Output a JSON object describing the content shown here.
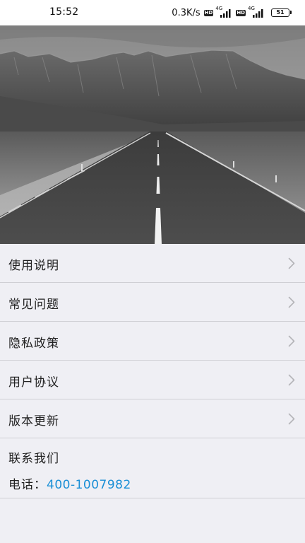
{
  "status_bar": {
    "time": "15:52",
    "net_speed": "0.3K/s",
    "hd_label": "HD",
    "sim1_tech": "4G",
    "sim2_tech": "4G",
    "battery": "51"
  },
  "hero": {
    "image": "mountain-road-photo"
  },
  "menu": {
    "items": [
      {
        "label": "使用说明"
      },
      {
        "label": "常见问题"
      },
      {
        "label": "隐私政策"
      },
      {
        "label": "用户协议"
      },
      {
        "label": "版本更新"
      }
    ],
    "chevron_icon": "chevron-right-icon"
  },
  "contact": {
    "title": "联系我们",
    "phone_label": "电话：",
    "phone_number": "400-1007982"
  },
  "colors": {
    "background": "#efeff4",
    "divider": "#cfcfd4",
    "link": "#1a8fd6",
    "text": "#222222"
  }
}
